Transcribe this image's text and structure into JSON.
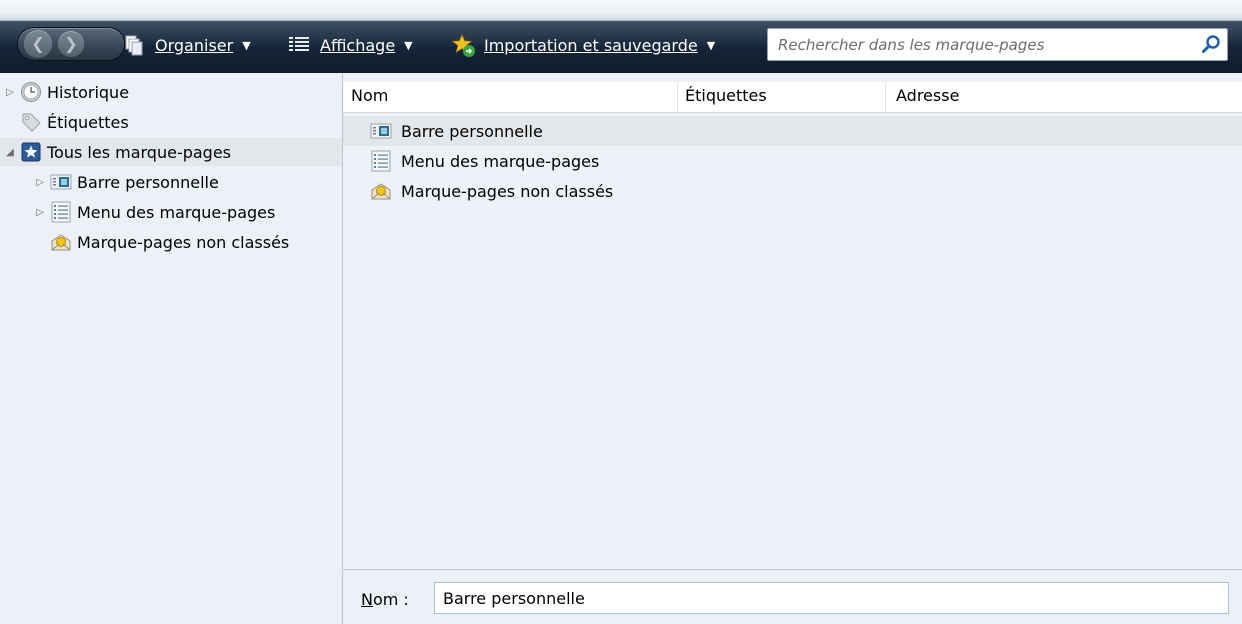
{
  "toolbar": {
    "organize_label": "Organiser",
    "view_label": "Affichage",
    "import_label": "Importation et sauvegarde",
    "search_placeholder": "Rechercher dans les marque-pages"
  },
  "sidebar": {
    "items": [
      {
        "label": "Historique",
        "icon": "clock-icon"
      },
      {
        "label": "Étiquettes",
        "icon": "tag-icon"
      },
      {
        "label": "Tous les marque-pages",
        "icon": "bookmark-star-icon"
      },
      {
        "label": "Barre personnelle",
        "icon": "toolbar-folder-icon"
      },
      {
        "label": "Menu des marque-pages",
        "icon": "menu-list-icon"
      },
      {
        "label": "Marque-pages non classés",
        "icon": "unsorted-bookmarks-icon"
      }
    ]
  },
  "table": {
    "columns": [
      "Nom",
      "Étiquettes",
      "Adresse"
    ],
    "rows": [
      {
        "name": "Barre personnelle",
        "icon": "toolbar-folder-icon"
      },
      {
        "name": "Menu des marque-pages",
        "icon": "menu-list-icon"
      },
      {
        "name": "Marque-pages non classés",
        "icon": "unsorted-bookmarks-icon"
      }
    ]
  },
  "details": {
    "name_label_prefix": "N",
    "name_label_rest": "om :",
    "name_value": "Barre personnelle"
  },
  "colors": {
    "toolbar_dark": "#16263a",
    "pane_bg": "#ecf1f8",
    "selection": "#e3e6ea"
  }
}
